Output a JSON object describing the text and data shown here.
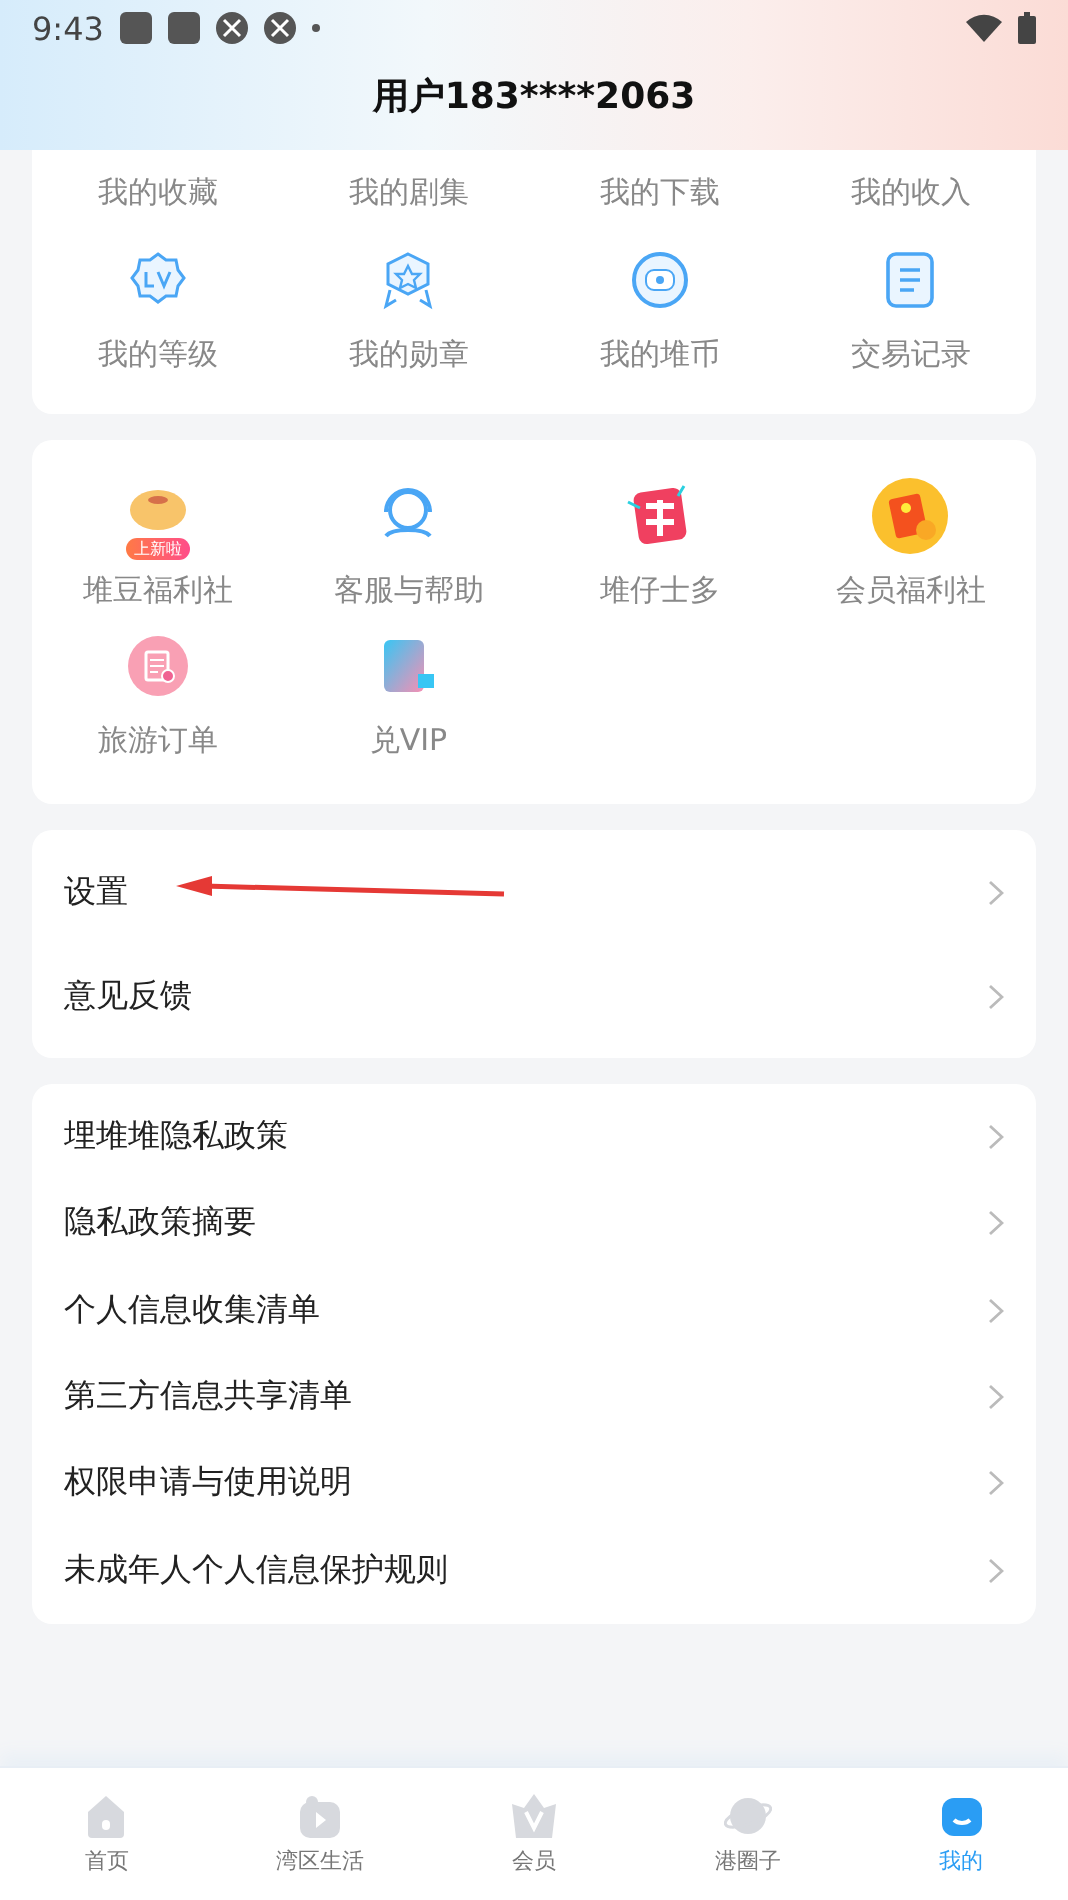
{
  "status_bar": {
    "time": "9:43"
  },
  "header": {
    "title": "用户183****2063"
  },
  "grid_1": {
    "items": [
      {
        "label": "我的收藏",
        "kind": "hidden"
      },
      {
        "label": "我的剧集",
        "kind": "hidden"
      },
      {
        "label": "我的下载",
        "kind": "hidden"
      },
      {
        "label": "我的收入",
        "kind": "hidden"
      },
      {
        "label": "我的等级",
        "kind": "level"
      },
      {
        "label": "我的勋章",
        "kind": "medal"
      },
      {
        "label": "我的堆币",
        "kind": "coin"
      },
      {
        "label": "交易记录",
        "kind": "record"
      }
    ]
  },
  "grid_2": {
    "items": [
      {
        "label": "堆豆福利社",
        "kind": "bean",
        "badge": "上新啦"
      },
      {
        "label": "客服与帮助",
        "kind": "service"
      },
      {
        "label": "堆仔士多",
        "kind": "shop"
      },
      {
        "label": "会员福利社",
        "kind": "welfare"
      },
      {
        "label": "旅游订单",
        "kind": "travel"
      },
      {
        "label": "兑VIP",
        "kind": "vip"
      }
    ]
  },
  "menu_groups": [
    {
      "items": [
        {
          "label": "设置",
          "annotated": true
        },
        {
          "label": "意见反馈",
          "annotated": false
        }
      ]
    },
    {
      "items": [
        {
          "label": "埋堆堆隐私政策",
          "annotated": false
        },
        {
          "label": "隐私政策摘要",
          "annotated": false
        },
        {
          "label": "个人信息收集清单",
          "annotated": false
        },
        {
          "label": "第三方信息共享清单",
          "annotated": false
        },
        {
          "label": "权限申请与使用说明",
          "annotated": false
        },
        {
          "label": "未成年人个人信息保护规则",
          "annotated": false
        }
      ]
    }
  ],
  "tab_bar": {
    "items": [
      {
        "label": "首页",
        "kind": "home",
        "selected": false
      },
      {
        "label": "湾区生活",
        "kind": "life",
        "selected": false
      },
      {
        "label": "会员",
        "kind": "vip",
        "selected": false
      },
      {
        "label": "港圈子",
        "kind": "circle",
        "selected": false
      },
      {
        "label": "我的",
        "kind": "mine",
        "selected": true
      }
    ]
  }
}
